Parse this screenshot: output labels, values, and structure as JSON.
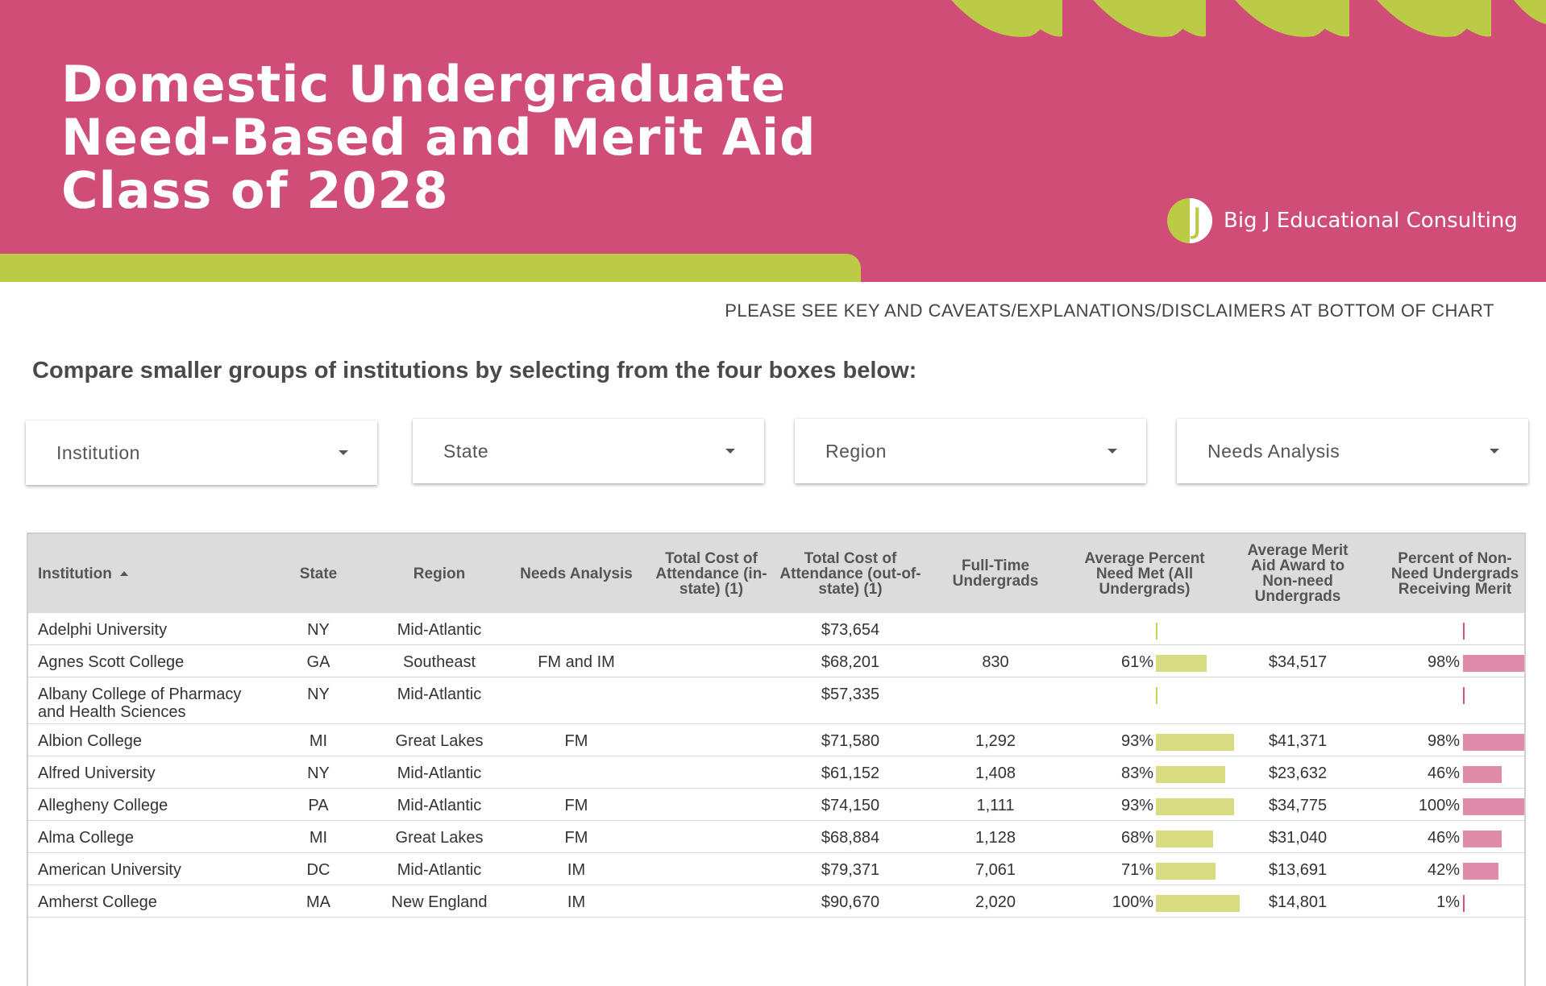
{
  "header": {
    "title_lines": [
      "Domestic Undergraduate",
      "Need-Based and Merit Aid",
      "Class of 2028"
    ],
    "brand_name": "Big J Educational Consulting",
    "brand_logo_letter": "J"
  },
  "notice": "PLEASE SEE KEY AND CAVEATS/EXPLANATIONS/DISCLAIMERS AT BOTTOM OF CHART",
  "instruction": "Compare smaller groups of institutions by selecting from the four boxes below:",
  "filters": [
    {
      "label": "Institution"
    },
    {
      "label": "State"
    },
    {
      "label": "Region"
    },
    {
      "label": "Needs Analysis"
    }
  ],
  "colors": {
    "banner": "#d04d78",
    "accent_green": "#bccb45",
    "bar_green": "#d7dc82",
    "bar_pink": "#e18bab",
    "header_bg": "#dcdcdc"
  },
  "table": {
    "columns": [
      "Institution",
      "State",
      "Region",
      "Needs Analysis",
      "Total Cost of Attendance (in-state) (1)",
      "Total Cost of Attendance (out-of-state) (1)",
      "Full-Time Undergrads",
      "Average Percent Need Met (All Undergrads)",
      "Average Merit Aid Award to Non-need Undergrads",
      "Percent of Non-Need Undergrads Receiving Merit"
    ],
    "sort": {
      "column": "Institution",
      "direction": "ascending"
    },
    "rows": [
      {
        "institution": "Adelphi University",
        "state": "NY",
        "region": "Mid-Atlantic",
        "needs": "",
        "cost_in": "",
        "cost_out": "$73,654",
        "ft": "",
        "need_met": "",
        "need_met_value": null,
        "merit_avg": "",
        "merit_pct": "",
        "merit_pct_value": null
      },
      {
        "institution": "Agnes Scott College",
        "state": "GA",
        "region": "Southeast",
        "needs": "FM and IM",
        "cost_in": "",
        "cost_out": "$68,201",
        "ft": "830",
        "need_met": "61%",
        "need_met_value": 61,
        "merit_avg": "$34,517",
        "merit_pct": "98%",
        "merit_pct_value": 98
      },
      {
        "institution": "Albany College of Pharmacy and Health Sciences",
        "state": "NY",
        "region": "Mid-Atlantic",
        "needs": "",
        "cost_in": "",
        "cost_out": "$57,335",
        "ft": "",
        "need_met": "",
        "need_met_value": null,
        "merit_avg": "",
        "merit_pct": "",
        "merit_pct_value": null
      },
      {
        "institution": "Albion College",
        "state": "MI",
        "region": "Great Lakes",
        "needs": "FM",
        "cost_in": "",
        "cost_out": "$71,580",
        "ft": "1,292",
        "need_met": "93%",
        "need_met_value": 93,
        "merit_avg": "$41,371",
        "merit_pct": "98%",
        "merit_pct_value": 98
      },
      {
        "institution": "Alfred University",
        "state": "NY",
        "region": "Mid-Atlantic",
        "needs": "",
        "cost_in": "",
        "cost_out": "$61,152",
        "ft": "1,408",
        "need_met": "83%",
        "need_met_value": 83,
        "merit_avg": "$23,632",
        "merit_pct": "46%",
        "merit_pct_value": 46
      },
      {
        "institution": "Allegheny College",
        "state": "PA",
        "region": "Mid-Atlantic",
        "needs": "FM",
        "cost_in": "",
        "cost_out": "$74,150",
        "ft": "1,111",
        "need_met": "93%",
        "need_met_value": 93,
        "merit_avg": "$34,775",
        "merit_pct": "100%",
        "merit_pct_value": 100
      },
      {
        "institution": "Alma College",
        "state": "MI",
        "region": "Great Lakes",
        "needs": "FM",
        "cost_in": "",
        "cost_out": "$68,884",
        "ft": "1,128",
        "need_met": "68%",
        "need_met_value": 68,
        "merit_avg": "$31,040",
        "merit_pct": "46%",
        "merit_pct_value": 46
      },
      {
        "institution": "American University",
        "state": "DC",
        "region": "Mid-Atlantic",
        "needs": "IM",
        "cost_in": "",
        "cost_out": "$79,371",
        "ft": "7,061",
        "need_met": "71%",
        "need_met_value": 71,
        "merit_avg": "$13,691",
        "merit_pct": "42%",
        "merit_pct_value": 42
      },
      {
        "institution": "Amherst College",
        "state": "MA",
        "region": "New England",
        "needs": "IM",
        "cost_in": "",
        "cost_out": "$90,670",
        "ft": "2,020",
        "need_met": "100%",
        "need_met_value": 100,
        "merit_avg": "$14,801",
        "merit_pct": "1%",
        "merit_pct_value": 1
      }
    ]
  }
}
